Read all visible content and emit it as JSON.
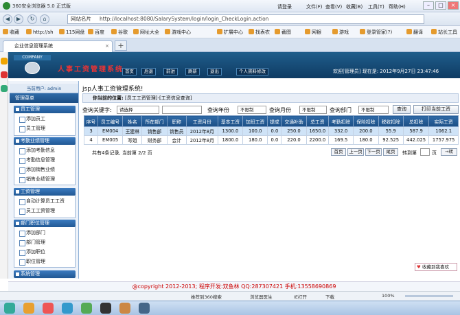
{
  "browser": {
    "title": "360安全浏览器 5.0 正式版",
    "menu": [
      "请登录",
      "文件(F)",
      "查看(V)",
      "收藏(B)",
      "工具(T)",
      "帮助(H)"
    ],
    "url_label": "网站名片",
    "url": "http://localhost:8080/SalarySystem/login/login_CheckLogin.action",
    "bookmarks": [
      "收藏",
      "http://sh",
      "115网盘",
      "百度",
      "谷歌",
      "网址大全",
      "游戏中心",
      "扩展中心",
      "找表农",
      "截图",
      "网银",
      "游戏",
      "登录管家(?)",
      "翻译",
      "站长工具"
    ],
    "tab": "企业信息管理系统",
    "status_items": [
      "推荐到360搜索",
      "浏览器医生",
      "IE打开",
      "下载",
      "100%"
    ]
  },
  "app": {
    "company": "COMPANY",
    "title": "人事工资管理系统",
    "toolbar": [
      "首页",
      "后退",
      "前进",
      "刷新",
      "退出",
      "个人资料修改"
    ],
    "welcome": "欢迎[管理员]",
    "now": "现在是: 2012年9月27日 23:47:46",
    "current_user": "当前用户: admin",
    "main_menu": "管理菜单",
    "welcome_msg": "jsp人事工资管理系统!",
    "location_label": "你当前的位置:",
    "location": "[员工工资管理]-[工资信息查询]",
    "favorite": "收藏到我喜欢",
    "copyright": "@copyright 2012-2013;  程序开发:双鱼林  QQ:287307421  手机:13558690869"
  },
  "menu_sections": [
    {
      "title": "员工管理",
      "items": [
        "添加员工",
        "员工管理"
      ]
    },
    {
      "title": "考勤业绩管理",
      "items": [
        "添加考勤信息",
        "考勤信息管理",
        "添加销售业绩",
        "销售业绩管理"
      ]
    },
    {
      "title": "工资管理",
      "items": [
        "自动计算员工工资",
        "员工工资管理"
      ]
    },
    {
      "title": "部门职位管理",
      "items": [
        "添加部门",
        "部门管理",
        "添加职位",
        "职位管理"
      ]
    },
    {
      "title": "系统管理",
      "items": []
    }
  ],
  "search": {
    "keyword_label": "查询关键字:",
    "keyword_select": "请选择",
    "year_label": "查询年份",
    "month_label": "查询月份",
    "dept_label": "查询部门",
    "no_limit": "不限制",
    "query_btn": "查询",
    "print_btn": "打印当前工资"
  },
  "table": {
    "headers": [
      "序号",
      "员工编号",
      "姓名",
      "所在部门",
      "职称",
      "工资月份",
      "基本工资",
      "加班工资",
      "提成",
      "交通补助",
      "总工资",
      "考勤扣除",
      "保险扣除",
      "税收扣除",
      "总扣除",
      "实际工资"
    ],
    "rows": [
      [
        "3",
        "EM004",
        "王建林",
        "销售部",
        "销售员",
        "2012年8月",
        "1300.0",
        "100.0",
        "0.0",
        "250.0",
        "1650.0",
        "332.0",
        "200.0",
        "55.9",
        "587.9",
        "1062.1"
      ],
      [
        "4",
        "EM005",
        "写姐",
        "财务部",
        "会计",
        "2012年8月",
        "1800.0",
        "180.0",
        "0.0",
        "220.0",
        "2200.0",
        "169.5",
        "180.0",
        "92.525",
        "442.025",
        "1757.975"
      ]
    ]
  },
  "pager": {
    "summary": "共有4条记录, 当前第 2/2 页",
    "buttons": [
      "首页",
      "上一页",
      "下一页",
      "尾页"
    ],
    "goto_label": "转到第",
    "page_unit": "页",
    "go": "→转"
  }
}
